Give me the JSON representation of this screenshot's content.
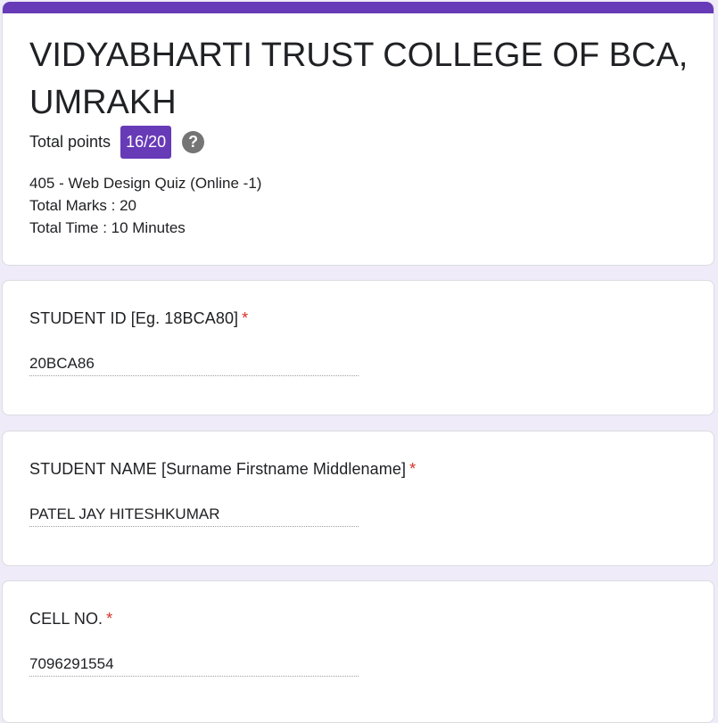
{
  "header": {
    "title": "VIDYABHARTI TRUST COLLEGE OF BCA, UMRAKH",
    "points_label": "Total points",
    "points_value": "16/20",
    "help_glyph": "?",
    "description": [
      "405 - Web Design Quiz (Online -1)",
      "Total Marks : 20",
      "Total Time : 10 Minutes"
    ]
  },
  "questions": [
    {
      "label": "STUDENT ID [Eg. 18BCA80]",
      "required": "*",
      "answer": "20BCA86"
    },
    {
      "label": "STUDENT NAME [Surname Firstname Middlename]",
      "required": "*",
      "answer": "PATEL JAY HITESHKUMAR"
    },
    {
      "label": "CELL NO.",
      "required": "*",
      "answer": "7096291554"
    }
  ],
  "colors": {
    "accent": "#673ab7",
    "background": "#efebf8",
    "required": "#d93025"
  },
  "icons": {
    "help": "help-circle-icon"
  }
}
